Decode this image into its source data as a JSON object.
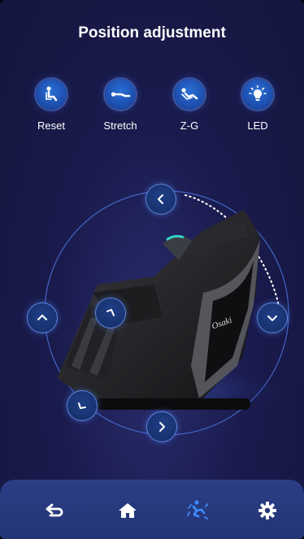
{
  "header": {
    "title": "Position adjustment"
  },
  "modes": [
    {
      "label": "Reset",
      "icon": "recline-person-icon"
    },
    {
      "label": "Stretch",
      "icon": "stretch-person-icon"
    },
    {
      "label": "Z-G",
      "icon": "zero-gravity-person-icon"
    },
    {
      "label": "LED",
      "icon": "light-bulb-icon"
    }
  ],
  "chair": {
    "brand": "Osaki"
  },
  "controls": [
    {
      "name": "backrest-left-button",
      "icon": "chevron-left-icon"
    },
    {
      "name": "backrest-up-button",
      "icon": "chevron-up-icon"
    },
    {
      "name": "recline-button",
      "icon": "angle-icon"
    },
    {
      "name": "backrest-down-button",
      "icon": "chevron-down-icon"
    },
    {
      "name": "leg-angle-button",
      "icon": "leg-angle-icon"
    },
    {
      "name": "backrest-right-button",
      "icon": "chevron-right-icon"
    }
  ],
  "navbar": {
    "items": [
      {
        "icon": "back-arrow-icon"
      },
      {
        "icon": "home-icon"
      },
      {
        "icon": "massage-person-icon",
        "active": true
      },
      {
        "icon": "gear-icon"
      }
    ],
    "active_color": "#3b8bff",
    "inactive_color": "#ffffff"
  }
}
